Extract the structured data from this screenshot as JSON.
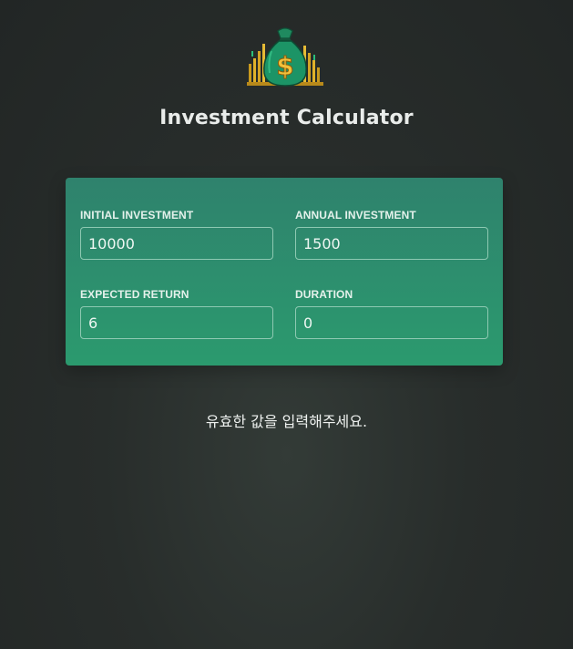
{
  "header": {
    "logo_icon": "money-bag-dollar-icon",
    "title": "Investment Calculator"
  },
  "form": {
    "initial_investment": {
      "label": "INITIAL INVESTMENT",
      "value": "10000"
    },
    "annual_investment": {
      "label": "ANNUAL INVESTMENT",
      "value": "1500"
    },
    "expected_return": {
      "label": "EXPECTED RETURN",
      "value": "6"
    },
    "duration": {
      "label": "DURATION",
      "value": "0"
    }
  },
  "result": {
    "message": "유효한 값을 입력해주세요."
  },
  "colors": {
    "card_top": "#2f826d",
    "card_bottom": "#2b9a6e",
    "background": "#282d2b"
  }
}
